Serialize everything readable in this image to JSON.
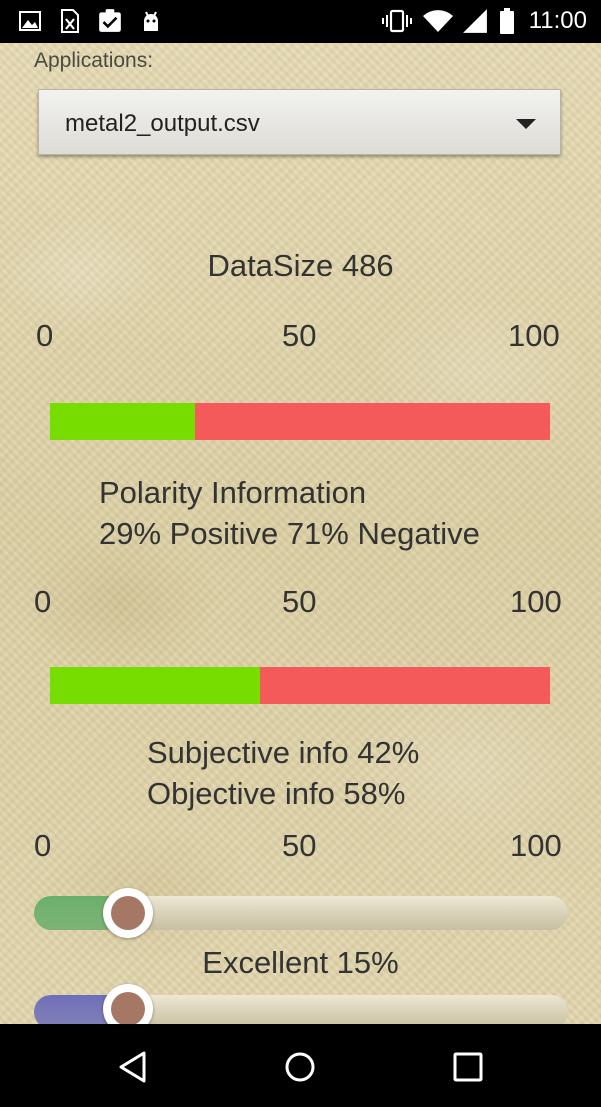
{
  "status_bar": {
    "time": "11:00",
    "left_icons": [
      "image-icon",
      "excel-file-icon",
      "clipboard-check-icon",
      "android-icon"
    ],
    "right_icons": [
      "vibrate-icon",
      "wifi-icon",
      "signal-icon",
      "battery-icon"
    ]
  },
  "applications": {
    "label": "Applications:",
    "selected": "metal2_output.csv"
  },
  "datasize": {
    "label": "DataSize 486"
  },
  "scale1": {
    "min": "0",
    "mid": "50",
    "max": "100"
  },
  "polarity": {
    "positive_fraction": 0.29,
    "line1": "Polarity Information",
    "line2": "29% Positive 71% Negative",
    "colors": {
      "positive": "#77dd00",
      "negative": "#f55a5a"
    }
  },
  "scale2": {
    "min": "0",
    "mid": "50",
    "max": "100"
  },
  "subjectivity": {
    "subjective_fraction": 0.42,
    "line1": "Subjective info  42%",
    "line2": "Objective info 58%"
  },
  "scale3": {
    "min": "0",
    "mid": "50",
    "max": "100"
  },
  "excellent": {
    "value_fraction": 0.15,
    "label": "Excellent 15%",
    "color": "#6aae6a"
  },
  "next_slider": {
    "value_fraction": 0.15,
    "color": "#6e6eb8"
  },
  "navbar": {
    "buttons": [
      "back-icon",
      "home-icon",
      "recents-icon"
    ]
  }
}
